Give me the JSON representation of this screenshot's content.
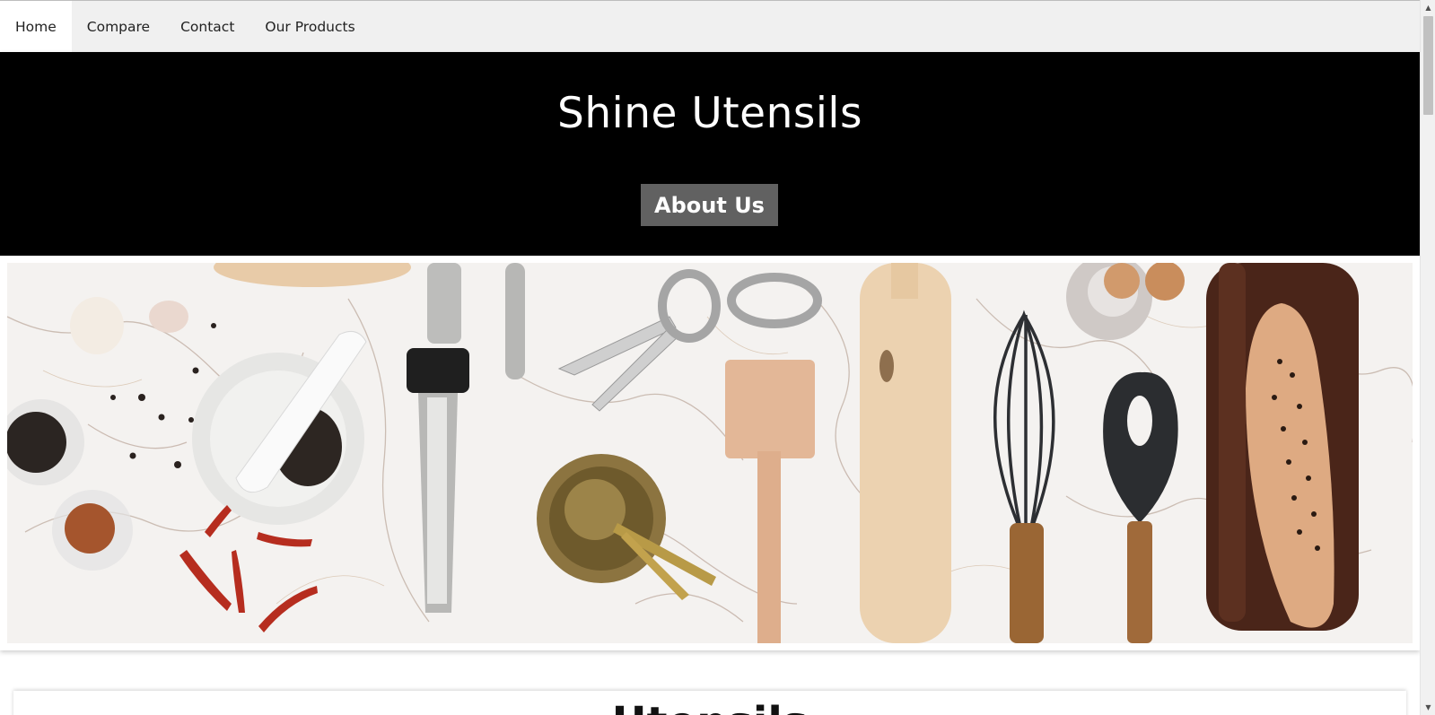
{
  "nav": {
    "items": [
      {
        "label": "Home",
        "active": true
      },
      {
        "label": "Compare",
        "active": false
      },
      {
        "label": "Contact",
        "active": false
      },
      {
        "label": "Our Products",
        "active": false
      }
    ]
  },
  "header": {
    "title": "Shine Utensils",
    "about_button": "About Us"
  },
  "banner": {
    "image_subject": "kitchen utensils on marble countertop"
  },
  "section": {
    "heading": "Utensils"
  },
  "scrollbar": {
    "up_icon": "▲",
    "down_icon": "▼"
  },
  "colors": {
    "header_bg": "#000000",
    "nav_bg": "#f0f0f0",
    "button_bg": "#616161"
  }
}
